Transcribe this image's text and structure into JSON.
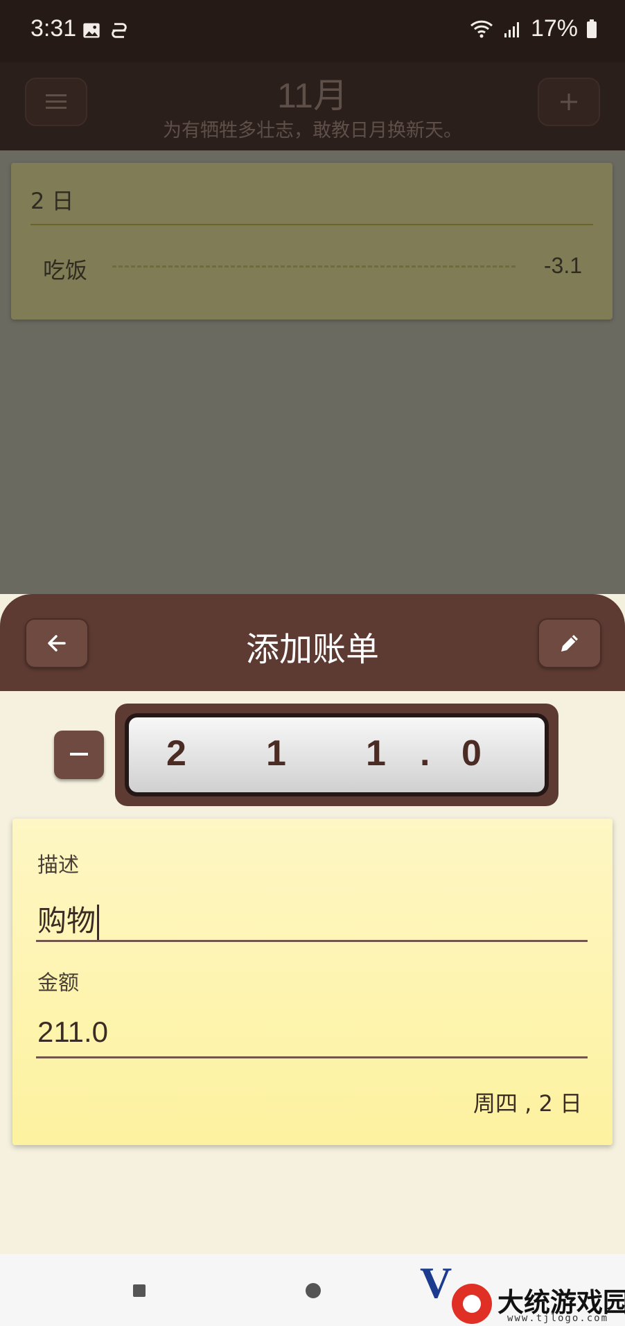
{
  "status_bar": {
    "time": "3:31",
    "battery": "17%"
  },
  "header": {
    "title": "11月",
    "subtitle": "为有牺牲多壮志，敢教日月换新天。"
  },
  "list": {
    "day_title": "2 日",
    "entries": [
      {
        "label": "吃饭",
        "amount": "-3.1"
      }
    ]
  },
  "sheet": {
    "title": "添加账单",
    "odometer_digits": [
      "2",
      "1",
      "1",
      ".",
      "0"
    ]
  },
  "form": {
    "description_label": "描述",
    "description_value": "购物",
    "amount_label": "金额",
    "amount_value": "211.0",
    "date": "周四 , 2 日"
  },
  "watermark": {
    "name": "大统游戏园",
    "url": "www.tjlogo.com"
  },
  "icons": [
    "image-icon",
    "sync-icon",
    "wifi-icon",
    "signal-icon",
    "battery-icon",
    "menu-icon",
    "plus-icon",
    "back-arrow-icon",
    "edit-icon",
    "minus-icon"
  ],
  "colors": {
    "sheet_brown": "#5d3b33",
    "card_yellow": "#fdf29f",
    "sheet_bg": "#f5f1de"
  }
}
